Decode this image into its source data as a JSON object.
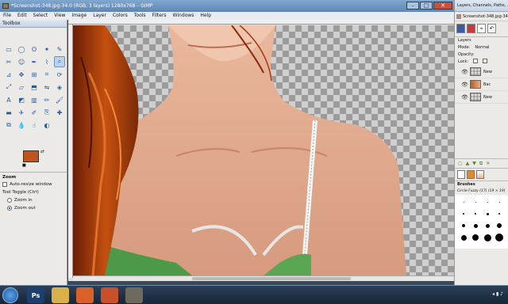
{
  "window": {
    "title": "*Screenshot-348.jpg-34.0 (RGB, 3 layers) 1280x768 – GIMP",
    "controls": [
      "–",
      "□",
      "✕"
    ]
  },
  "menubar": [
    "File",
    "Edit",
    "Select",
    "View",
    "Image",
    "Layer",
    "Colors",
    "Tools",
    "Filters",
    "Windows",
    "Help"
  ],
  "toolbox": {
    "title": "Toolbox",
    "tools": [
      {
        "icon": "rect-select-icon",
        "glyph": "▭"
      },
      {
        "icon": "ellipse-select-icon",
        "glyph": "◯"
      },
      {
        "icon": "free-select-icon",
        "glyph": "ʘ"
      },
      {
        "icon": "fuzzy-select-icon",
        "glyph": "✦"
      },
      {
        "icon": "color-picker-icon",
        "glyph": "✎"
      },
      {
        "icon": "scissors-select-icon",
        "glyph": "✂"
      },
      {
        "icon": "foreground-select-icon",
        "glyph": "☺"
      },
      {
        "icon": "paths-icon",
        "glyph": "✒"
      },
      {
        "icon": "eyedropper-icon",
        "glyph": "⌇"
      },
      {
        "icon": "zoom-icon",
        "glyph": "⌕"
      },
      {
        "icon": "measure-icon",
        "glyph": "⊿"
      },
      {
        "icon": "move-icon",
        "glyph": "✥"
      },
      {
        "icon": "align-icon",
        "glyph": "⊞"
      },
      {
        "icon": "crop-icon",
        "glyph": "⌗"
      },
      {
        "icon": "rotate-icon",
        "glyph": "⟳"
      },
      {
        "icon": "scale-icon",
        "glyph": "⤢"
      },
      {
        "icon": "shear-icon",
        "glyph": "▱"
      },
      {
        "icon": "perspective-icon",
        "glyph": "⬒"
      },
      {
        "icon": "flip-icon",
        "glyph": "⇋"
      },
      {
        "icon": "cage-icon",
        "glyph": "◈"
      },
      {
        "icon": "text-icon",
        "glyph": "A"
      },
      {
        "icon": "bucket-fill-icon",
        "glyph": "◩"
      },
      {
        "icon": "blend-icon",
        "glyph": "▥"
      },
      {
        "icon": "pencil-icon",
        "glyph": "✏"
      },
      {
        "icon": "paintbrush-icon",
        "glyph": "🖌"
      },
      {
        "icon": "eraser-icon",
        "glyph": "▬"
      },
      {
        "icon": "airbrush-icon",
        "glyph": "✈"
      },
      {
        "icon": "ink-icon",
        "glyph": "✐"
      },
      {
        "icon": "clone-icon",
        "glyph": "⎘"
      },
      {
        "icon": "heal-icon",
        "glyph": "✚"
      },
      {
        "icon": "perspective-clone-icon",
        "glyph": "⧉"
      },
      {
        "icon": "blur-icon",
        "glyph": "💧"
      },
      {
        "icon": "smudge-icon",
        "glyph": "☝"
      },
      {
        "icon": "dodge-burn-icon",
        "glyph": "◐"
      }
    ],
    "active_tool": 9,
    "colors": {
      "foreground": "#c0521a",
      "background": "#ffffff"
    },
    "options": {
      "header": "Zoom",
      "auto_resize_label": "Auto-resize window",
      "toggle_label": "Tool Toggle  (Ctrl)",
      "zoom_in_label": "Zoom in",
      "zoom_out_label": "Zoom out",
      "selected": "Zoom out"
    }
  },
  "dock": {
    "title": "Layers, Channels, Paths, ...",
    "image_select": "Screenshot-348.jpg-34",
    "layers_header": "Layers",
    "mode_label": "Mode:",
    "mode_value": "Normal",
    "opacity_label": "Opacity:",
    "lock_label": "Lock:",
    "layers": [
      {
        "name": "New",
        "thumb": "checker"
      },
      {
        "name": "Bac",
        "thumb": "photo"
      },
      {
        "name": "New",
        "thumb": "checker"
      }
    ],
    "brushes_header": "Brushes",
    "brush_name": "Circle Fuzzy (17) (19 × 19)",
    "brush_sizes": [
      1,
      1,
      1,
      1,
      2,
      2,
      3,
      2,
      4,
      5,
      5,
      6,
      7,
      8,
      9,
      10
    ]
  },
  "taskbar": {
    "items": [
      {
        "icon": "photoshop-icon",
        "label": "Ps",
        "color": "#1c3f6e"
      },
      {
        "icon": "folder-icon",
        "label": "",
        "color": "#d9b04a"
      },
      {
        "icon": "firefox-icon",
        "label": "",
        "color": "#d9622b"
      },
      {
        "icon": "firefox-icon",
        "label": "",
        "color": "#c8502a"
      },
      {
        "icon": "gimp-icon",
        "label": "",
        "color": "#6f6a5e"
      }
    ]
  }
}
